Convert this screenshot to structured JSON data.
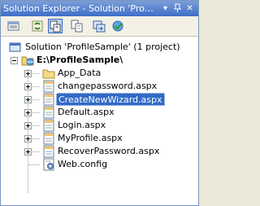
{
  "window": {
    "title": "Solution Explorer - Solution 'ProfileS...",
    "buttons": [
      "pin-dropdown",
      "pin",
      "close"
    ]
  },
  "toolbar": {
    "tools": [
      "properties",
      "refresh",
      "nest-related-files",
      "show-all-files",
      "copy-website",
      "asp-net-configuration"
    ]
  },
  "tree": {
    "solution": "Solution 'ProfileSample' (1 project)",
    "project": "E:\\ProfileSample\\",
    "items": [
      {
        "label": "App_Data",
        "type": "folder",
        "expandable": true
      },
      {
        "label": "changepassword.aspx",
        "type": "aspx",
        "expandable": true
      },
      {
        "label": "CreateNewWizard.aspx",
        "type": "aspx",
        "expandable": true,
        "selected": true
      },
      {
        "label": "Default.aspx",
        "type": "aspx",
        "expandable": true
      },
      {
        "label": "Login.aspx",
        "type": "aspx",
        "expandable": true
      },
      {
        "label": "MyProfile.aspx",
        "type": "aspx",
        "expandable": true
      },
      {
        "label": "RecoverPassword.aspx",
        "type": "aspx",
        "expandable": true
      },
      {
        "label": "Web.config",
        "type": "config",
        "expandable": false
      }
    ]
  },
  "colors": {
    "titlebar": "#3d6ec8",
    "selection": "#316ac5",
    "window_bg": "#ffffff"
  }
}
